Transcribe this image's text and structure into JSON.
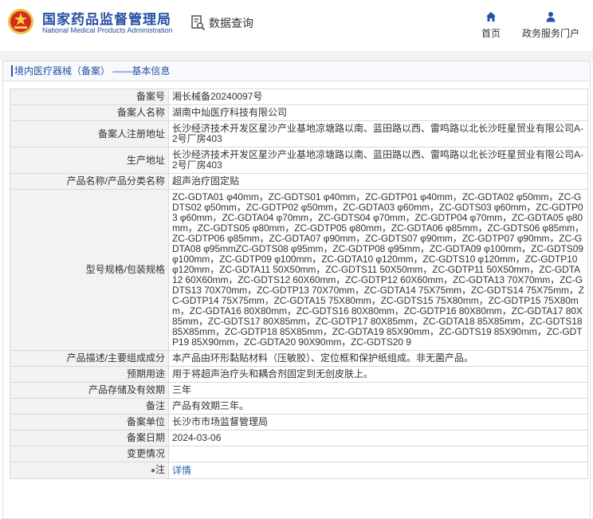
{
  "header": {
    "site_name_cn": "国家药品监督管理局",
    "site_name_en": "National Medical Products Administration",
    "query_label": "数据查询",
    "nav_home": "首页",
    "nav_service": "政务服务门户",
    "brand_color": "#2650a3"
  },
  "panel": {
    "title": "境内医疗器械（备案） ——基本信息"
  },
  "rows": [
    {
      "label": "备案号",
      "value": "湘长械备20240097号"
    },
    {
      "label": "备案人名称",
      "value": "湖南中灿医疗科技有限公司"
    },
    {
      "label": "备案人注册地址",
      "value": "长沙经济技术开发区星沙产业基地凉塘路以南、蓝田路以西、雷鸣路以北长沙旺星贸业有限公司A-2号厂房403"
    },
    {
      "label": "生产地址",
      "value": "长沙经济技术开发区星沙产业基地凉塘路以南、蓝田路以西、雷鸣路以北长沙旺星贸业有限公司A-2号厂房403"
    },
    {
      "label": "产品名称/产品分类名称",
      "value": "超声治疗固定贴"
    },
    {
      "label": "型号规格/包装规格",
      "value": "ZC-GDTA01 φ40mm，ZC-GDTS01 φ40mm，ZC-GDTP01 φ40mm，ZC-GDTA02 φ50mm，ZC-GDTS02 φ50mm，ZC-GDTP02 φ50mm，ZC-GDTA03 φ60mm，ZC-GDTS03 φ60mm，ZC-GDTP03 φ60mm，ZC-GDTA04 φ70mm，ZC-GDTS04 φ70mm，ZC-GDTP04 φ70mm，ZC-GDTA05 φ80mm，ZC-GDTS05 φ80mm，ZC-GDTP05 φ80mm，ZC-GDTA06 φ85mm，ZC-GDTS06 φ85mm，ZC-GDTP06 φ85mm，ZC-GDTA07 φ90mm，ZC-GDTS07 φ90mm，ZC-GDTP07 φ90mm，ZC-GDTA08 φ95mmZC-GDTS08 φ95mm，ZC-GDTP08 φ95mm，ZC-GDTA09 φ100mm，ZC-GDTS09 φ100mm，ZC-GDTP09 φ100mm，ZC-GDTA10 φ120mm，ZC-GDTS10 φ120mm，ZC-GDTP10 φ120mm，ZC-GDTA11 50X50mm，ZC-GDTS11 50X50mm，ZC-GDTP11 50X50mm，ZC-GDTA12 60X60mm，ZC-GDTS12 60X60mm，ZC-GDTP12 60X60mm，ZC-GDTA13 70X70mm，ZC-GDTS13 70X70mm，ZC-GDTP13 70X70mm，ZC-GDTA14 75X75mm，ZC-GDTS14 75X75mm，ZC-GDTP14 75X75mm，ZC-GDTA15 75X80mm，ZC-GDTS15 75X80mm，ZC-GDTP15 75X80mm，ZC-GDTA16 80X80mm，ZC-GDTS16 80X80mm，ZC-GDTP16 80X80mm，ZC-GDTA17 80X85mm，ZC-GDTS17 80X85mm，ZC-GDTP17 80X85mm，ZC-GDTA18 85X85mm，ZC-GDTS18 85X85mm，ZC-GDTP18 85X85mm，ZC-GDTA19 85X90mm，ZC-GDTS19 85X90mm，ZC-GDTP19 85X90mm，ZC-GDTA20 90X90mm，ZC-GDTS20 9"
    },
    {
      "label": "产品描述/主要组成成分",
      "value": "本产品由环形黏贴材料（压敏胶）、定位框和保护纸组成。非无菌产品。"
    },
    {
      "label": "预期用途",
      "value": "用于将超声治疗头和耦合剂固定到无创皮肤上。"
    },
    {
      "label": "产品存储及有效期",
      "value": "三年"
    },
    {
      "label": "备注",
      "value": "产品有效期三年。"
    },
    {
      "label": "备案单位",
      "value": "长沙市市场监督管理局"
    },
    {
      "label": "备案日期",
      "value": "2024-03-06"
    },
    {
      "label": "变更情况",
      "value": ""
    },
    {
      "label": "注",
      "value": "详情",
      "icon": "lightbulb-icon"
    }
  ]
}
